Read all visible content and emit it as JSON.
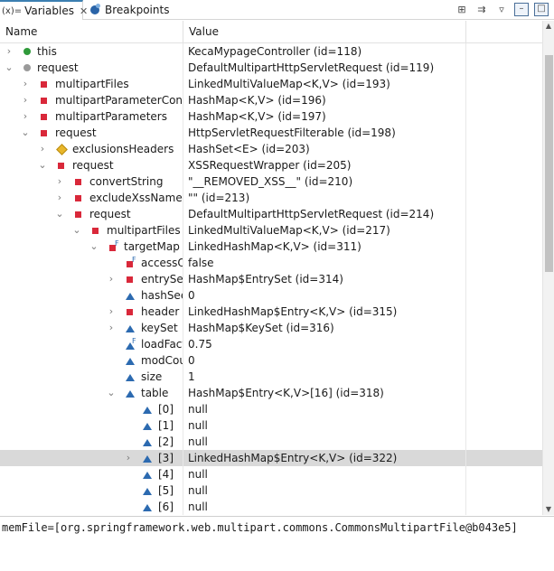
{
  "tabs": {
    "variables": {
      "icon": "(x)=",
      "label": "Variables"
    },
    "breakpoints": {
      "label": "Breakpoints"
    }
  },
  "toolbar": {
    "items": [
      "show-type-names-icon",
      "collapse-all-icon",
      "view-menu-icon",
      "minimize-icon",
      "maximize-icon"
    ]
  },
  "columns": {
    "name": "Name",
    "value": "Value"
  },
  "rows": [
    {
      "name": "this",
      "value": "KecaMypageController  (id=118)"
    },
    {
      "name": "request",
      "value": "DefaultMultipartHttpServletRequest  (id=119)"
    },
    {
      "name": "multipartFiles",
      "value": "LinkedMultiValueMap<K,V>  (id=193)"
    },
    {
      "name": "multipartParameterConten",
      "value": "HashMap<K,V>  (id=196)"
    },
    {
      "name": "multipartParameters",
      "value": "HashMap<K,V>  (id=197)"
    },
    {
      "name": "request",
      "value": "HttpServletRequestFilterable  (id=198)"
    },
    {
      "name": "exclusionsHeaders",
      "value": "HashSet<E>  (id=203)"
    },
    {
      "name": "request",
      "value": "XSSRequestWrapper  (id=205)"
    },
    {
      "name": "convertString",
      "value": "\"__REMOVED_XSS__\" (id=210)"
    },
    {
      "name": "excludeXssNames",
      "value": "\"\" (id=213)"
    },
    {
      "name": "request",
      "value": "DefaultMultipartHttpServletRequest  (id=214)"
    },
    {
      "name": "multipartFiles",
      "value": "LinkedMultiValueMap<K,V>  (id=217)"
    },
    {
      "name": "targetMap",
      "value": "LinkedHashMap<K,V>  (id=311)"
    },
    {
      "name": "accessOr",
      "value": "false"
    },
    {
      "name": "entrySet",
      "value": "HashMap$EntrySet  (id=314)"
    },
    {
      "name": "hashSeed",
      "value": "0"
    },
    {
      "name": "header",
      "value": "LinkedHashMap$Entry<K,V>  (id=315)"
    },
    {
      "name": "keySet",
      "value": "HashMap$KeySet  (id=316)"
    },
    {
      "name": "loadFact",
      "value": "0.75"
    },
    {
      "name": "modCou",
      "value": "0"
    },
    {
      "name": "size",
      "value": "1"
    },
    {
      "name": "table",
      "value": "HashMap$Entry<K,V>[16]  (id=318)"
    },
    {
      "name": "[0]",
      "value": "null"
    },
    {
      "name": "[1]",
      "value": "null"
    },
    {
      "name": "[2]",
      "value": "null"
    },
    {
      "name": "[3]",
      "value": "LinkedHashMap$Entry<K,V>  (id=322)"
    },
    {
      "name": "[4]",
      "value": "null"
    },
    {
      "name": "[5]",
      "value": "null"
    },
    {
      "name": "[6]",
      "value": "null"
    }
  ],
  "final_marker": "F",
  "detail": {
    "text": "memFile=[org.springframework.web.multipart.commons.CommonsMultipartFile@b043e5]"
  }
}
